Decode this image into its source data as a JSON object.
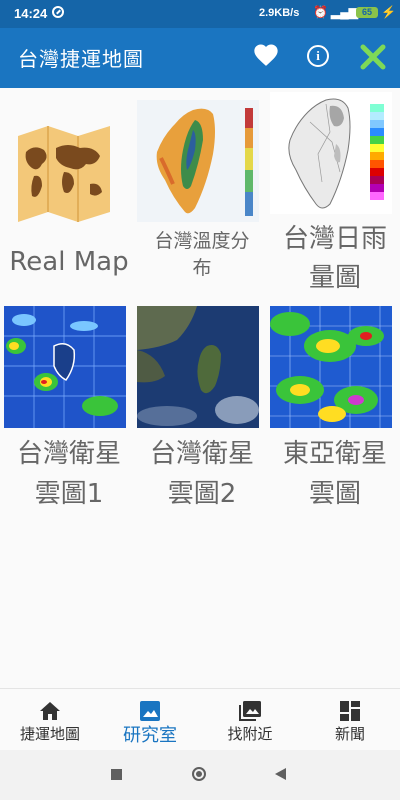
{
  "status": {
    "time": "14:24",
    "network_speed": "2.9KB/s",
    "battery": "65"
  },
  "appbar": {
    "title": "台灣捷運地圖"
  },
  "grid": {
    "items": [
      {
        "label": "Real Map"
      },
      {
        "label_line1": "台灣溫度分",
        "label_line2": "布"
      },
      {
        "label_line1": "台灣日雨",
        "label_line2": "量圖"
      },
      {
        "label_line1": "台灣衛星",
        "label_line2": "雲圖1"
      },
      {
        "label_line1": "台灣衛星",
        "label_line2": "雲圖2"
      },
      {
        "label_line1": "東亞衛星",
        "label_line2": "雲圖"
      }
    ]
  },
  "bottom_nav": {
    "items": [
      {
        "label": "捷運地圖",
        "icon": "home-icon"
      },
      {
        "label": "研究室",
        "icon": "image-icon"
      },
      {
        "label": "找附近",
        "icon": "photo-library-icon"
      },
      {
        "label": "新聞",
        "icon": "dashboard-icon"
      }
    ],
    "active_index": 1
  },
  "colors": {
    "primary": "#1a75c1",
    "status_bar": "#1565a8",
    "close_accent": "#7ed957",
    "label_gray": "#666666"
  }
}
